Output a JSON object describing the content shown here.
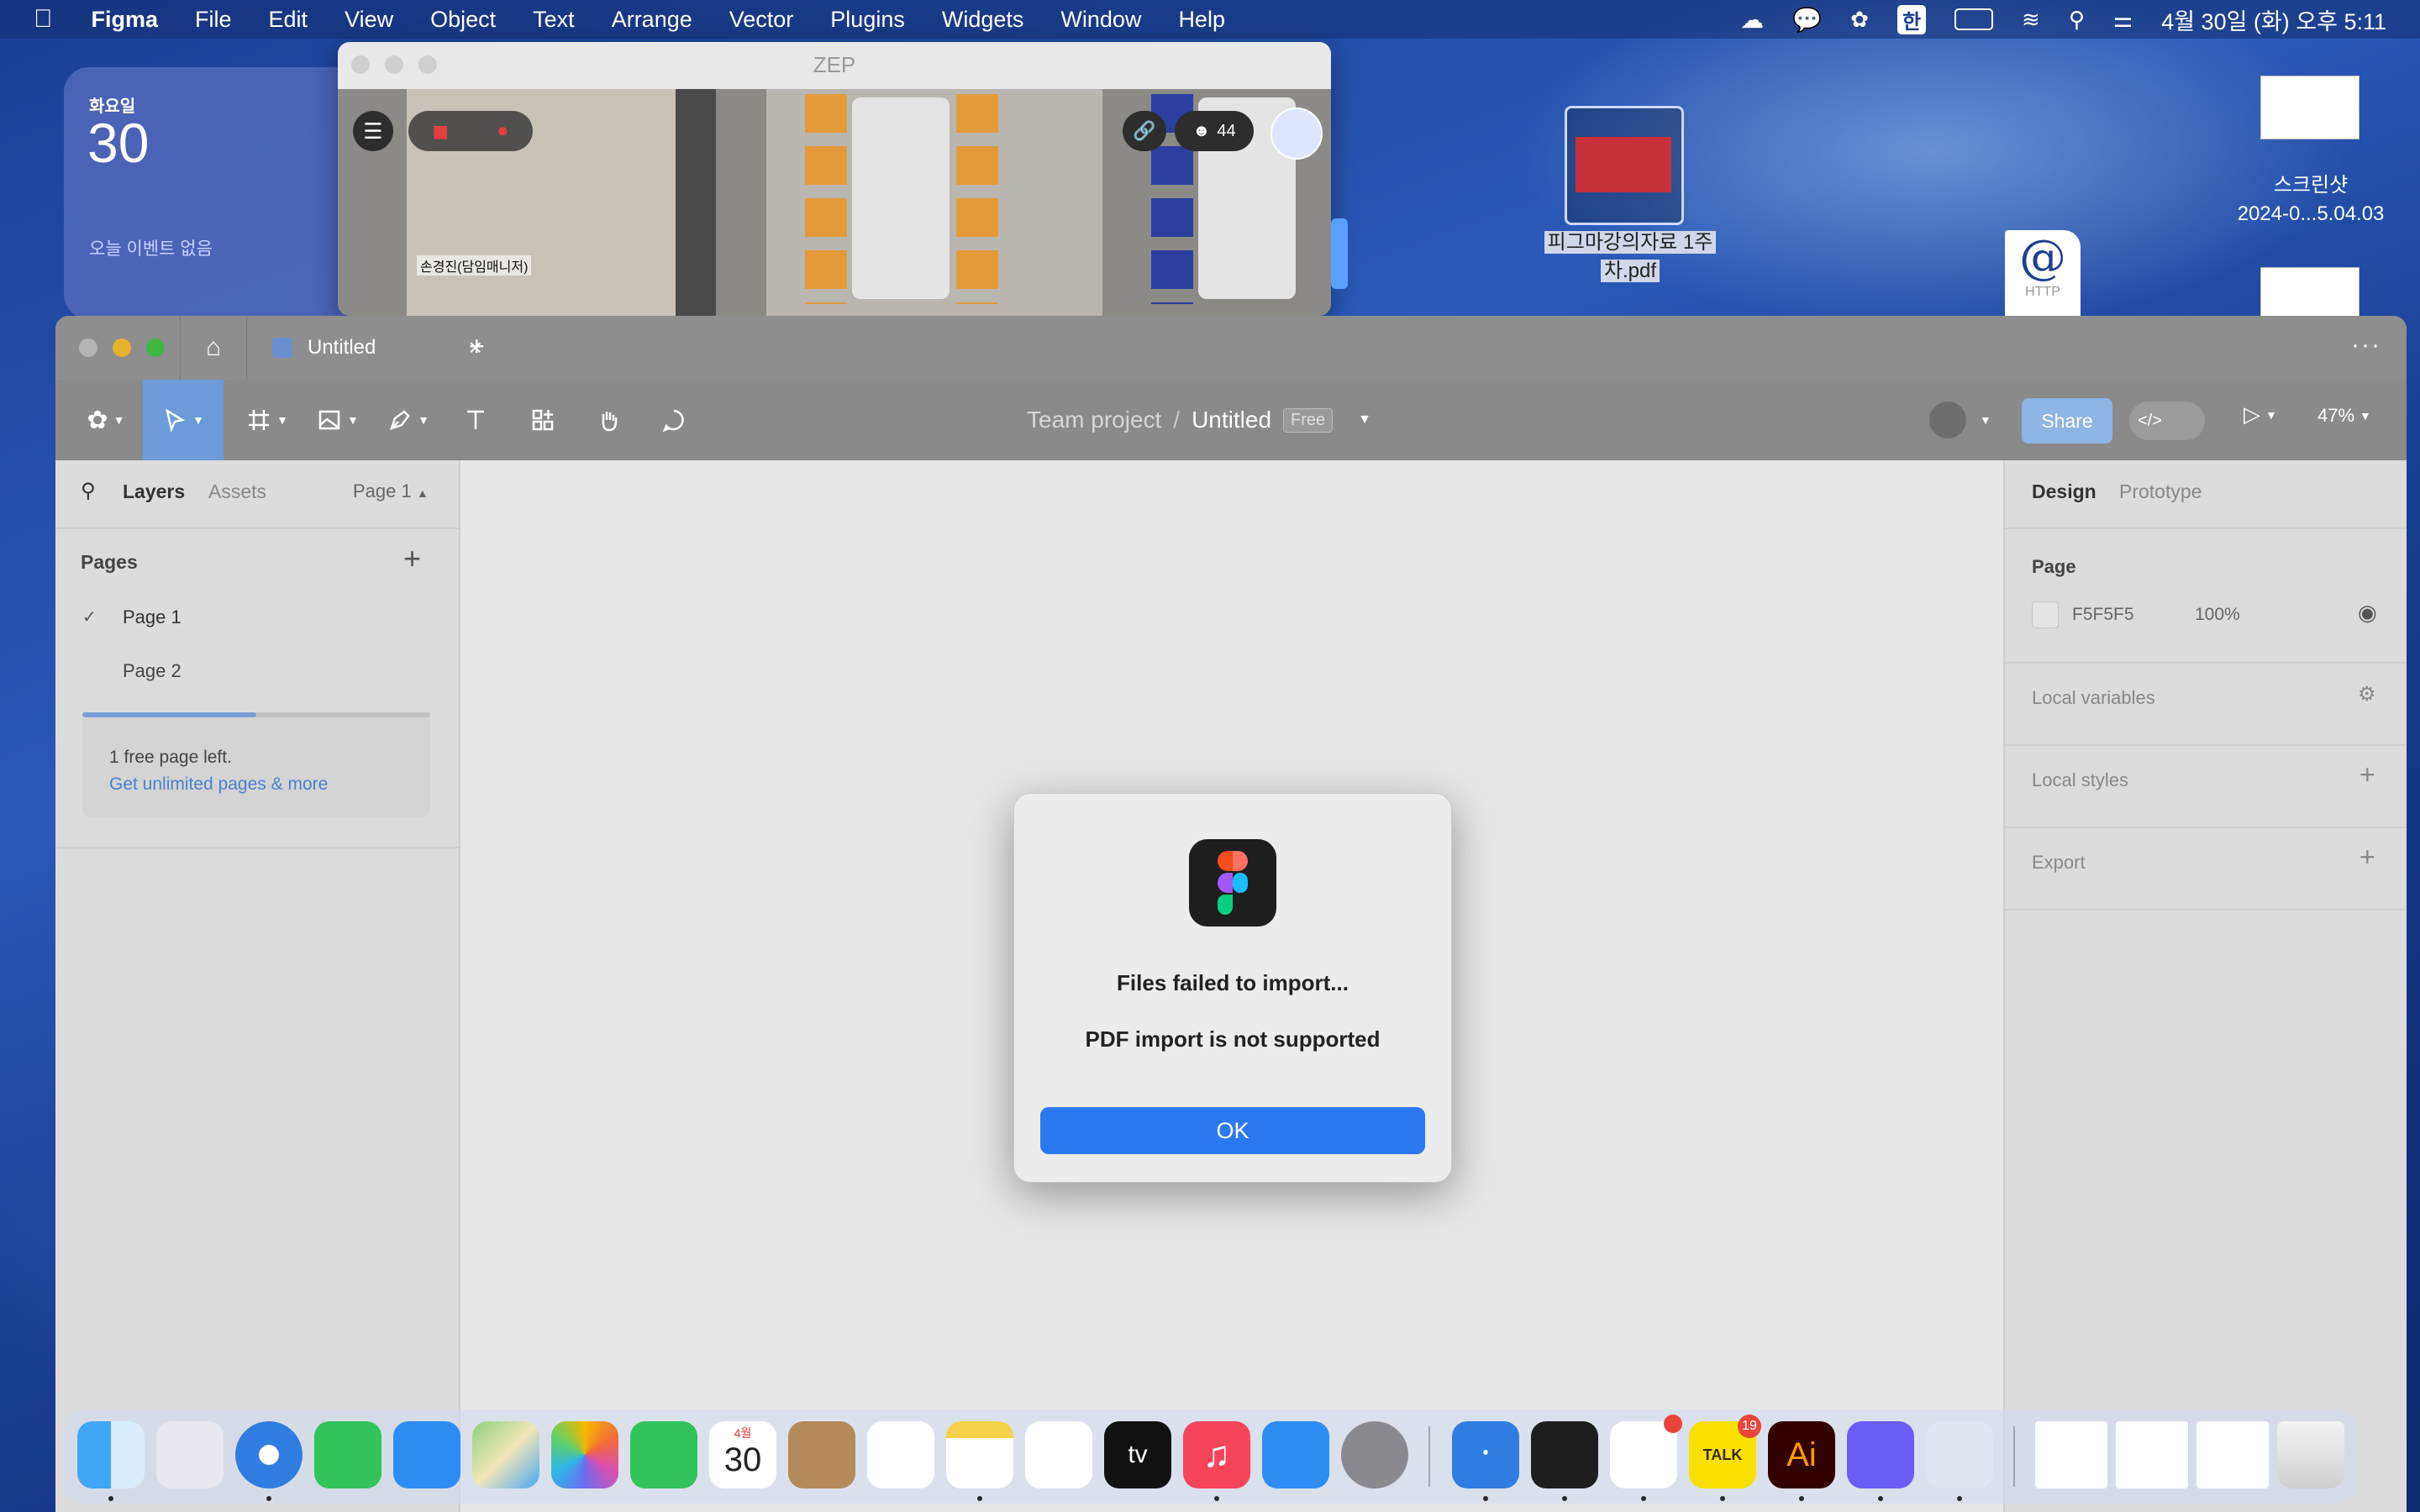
{
  "menubar": {
    "app_name": "Figma",
    "items": [
      "File",
      "Edit",
      "View",
      "Object",
      "Text",
      "Arrange",
      "Vector",
      "Plugins",
      "Widgets",
      "Window",
      "Help"
    ],
    "input_indicator": "한",
    "datetime": "4월 30일 (화) 오후 5:11"
  },
  "calendar_widget": {
    "weekday": "화요일",
    "day": "30",
    "no_events": "오늘 이벤트 없음"
  },
  "zep_window": {
    "title": "ZEP",
    "player_name": "손경진(담임매니저)",
    "user_count": "44"
  },
  "desktop_icons": {
    "pdf_label_line1": "피그마강의자료 1주",
    "pdf_label_line2": "차.pdf",
    "screenshot_label_line1": "스크린샷",
    "screenshot_label_line2": "2024-0...5.04.03",
    "http_label": "HTTP"
  },
  "figma": {
    "tab_title": "Untitled",
    "breadcrumb_team": "Team project",
    "breadcrumb_sep": "/",
    "file_name": "Untitled",
    "plan_badge": "Free",
    "share_label": "Share",
    "zoom": "47%",
    "left_panel": {
      "tabs": [
        "Layers",
        "Assets"
      ],
      "current_page": "Page 1",
      "pages_heading": "Pages",
      "pages": [
        "Page 1",
        "Page 2"
      ],
      "free_pages_note": "1 free page left.",
      "upgrade_link": "Get unlimited pages & more",
      "pages_used_fraction": 0.5
    },
    "right_panel": {
      "tabs": [
        "Design",
        "Prototype"
      ],
      "page_heading": "Page",
      "page_color": "F5F5F5",
      "page_opacity": "100%",
      "sections": [
        "Local variables",
        "Local styles",
        "Export"
      ]
    }
  },
  "dialog": {
    "title": "Files failed to import...",
    "message": "PDF import is not supported",
    "ok_label": "OK"
  },
  "dock": {
    "calendar_month": "4월",
    "calendar_day": "30",
    "slack_badge": "",
    "kakao_label": "TALK",
    "kakao_badge": "19",
    "illustrator_label": "Ai",
    "appletv_label": "tv"
  },
  "colors": {
    "accent_blue": "#2b79f0",
    "figma_toolbar": "#8a8a8a",
    "active_tool": "#6d9ad8",
    "desktop_blue": "#1f4aa6"
  }
}
